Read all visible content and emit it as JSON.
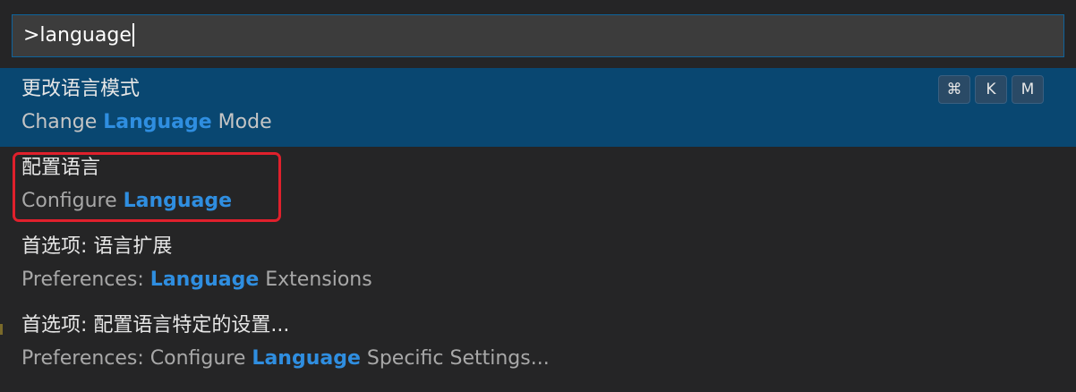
{
  "command_palette": {
    "input_value": ">language",
    "items": [
      {
        "title": "更改语言模式",
        "subtitle_before": "Change ",
        "subtitle_match": "Language",
        "subtitle_after": " Mode",
        "keybinding": [
          "⌘",
          "K",
          "M"
        ],
        "selected": true
      },
      {
        "title": "配置语言",
        "subtitle_before": "Configure ",
        "subtitle_match": "Language",
        "subtitle_after": "",
        "selected": false
      },
      {
        "title": "首选项: 语言扩展",
        "subtitle_before": "Preferences: ",
        "subtitle_match": "Language",
        "subtitle_after": " Extensions",
        "selected": false
      },
      {
        "title": "首选项: 配置语言特定的设置...",
        "subtitle_before": "Preferences: Configure ",
        "subtitle_match": "Language",
        "subtitle_after": " Specific Settings...",
        "selected": false
      }
    ]
  },
  "colors": {
    "background": "#252526",
    "selected_row": "#094771",
    "match_highlight": "#2f8ee0",
    "annotation_box": "#e0202c"
  }
}
